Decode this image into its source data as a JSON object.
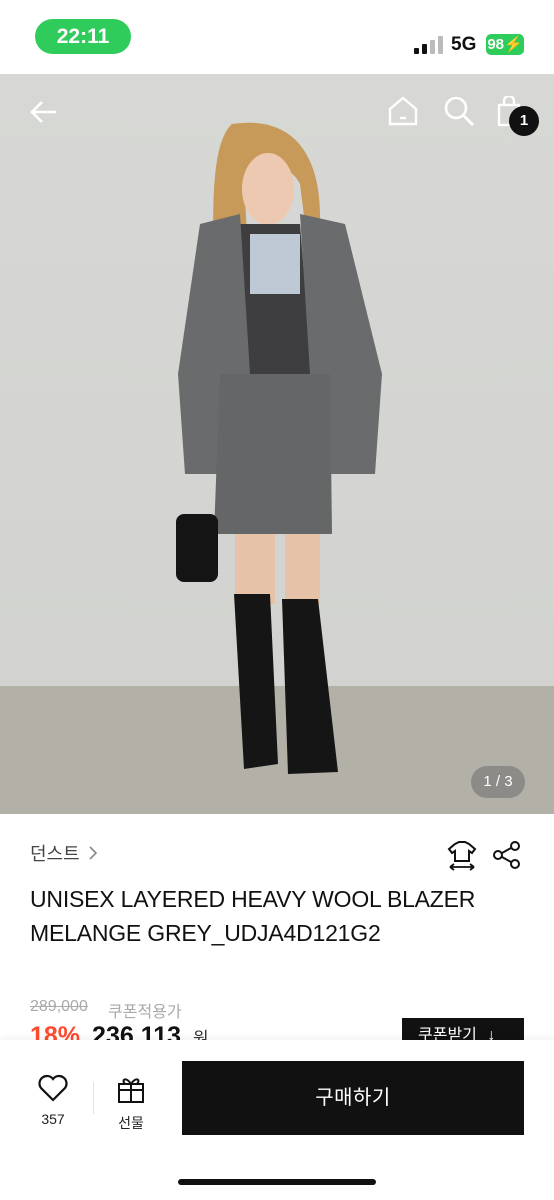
{
  "status_bar": {
    "time": "22:11",
    "network": "5G",
    "battery": "98"
  },
  "header": {
    "cart_count": "1"
  },
  "gallery": {
    "counter": "1 / 3"
  },
  "product": {
    "brand": "던스트",
    "title": "UNISEX LAYERED HEAVY WOOL BLAZER MELANGE GREY_UDJA4D121G2",
    "original_price": "289,000",
    "coupon_label": "쿠폰적용가",
    "discount": "18%",
    "price": "236,113",
    "currency": "원",
    "coupon_button": "쿠폰받기"
  },
  "bottom_bar": {
    "like_count": "357",
    "gift_label": "선물",
    "buy_label": "구매하기"
  },
  "colors": {
    "accent_green": "#2fcc5b",
    "discount_red": "#ff4a2f",
    "button_black": "#111111"
  }
}
